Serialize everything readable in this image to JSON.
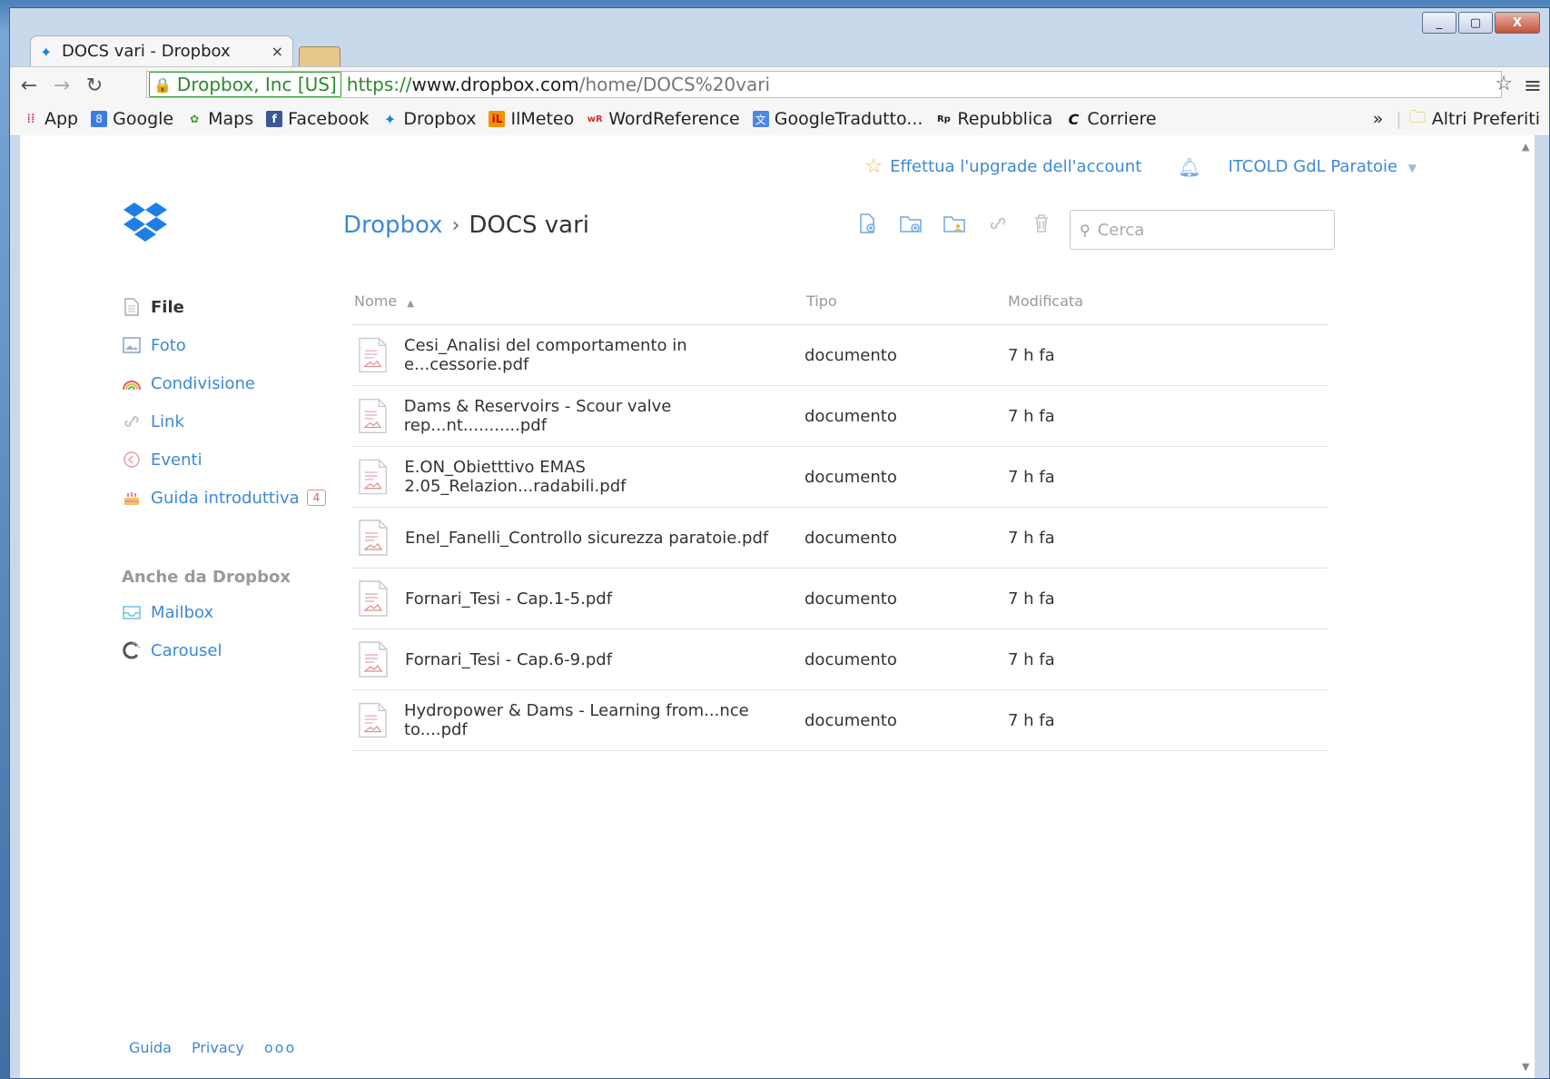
{
  "browser": {
    "tab_title": "DOCS vari - Dropbox",
    "tab_close": "×",
    "ev_label": "Dropbox, Inc [US]",
    "url_scheme": "https://",
    "url_host": "www.dropbox.com",
    "url_path": "/home/DOCS%20vari",
    "bookmarks": [
      {
        "label": "App",
        "icon": "apps-grid-icon"
      },
      {
        "label": "Google",
        "icon": "google-icon"
      },
      {
        "label": "Maps",
        "icon": "maps-icon"
      },
      {
        "label": "Facebook",
        "icon": "facebook-icon"
      },
      {
        "label": "Dropbox",
        "icon": "dropbox-icon"
      },
      {
        "label": "IlMeteo",
        "icon": "ilmeteo-icon"
      },
      {
        "label": "WordReference",
        "icon": "wordreference-icon"
      },
      {
        "label": "GoogleTradutto...",
        "icon": "google-translate-icon"
      },
      {
        "label": "Repubblica",
        "icon": "repubblica-icon"
      },
      {
        "label": "Corriere",
        "icon": "corriere-icon"
      }
    ],
    "overflow": "»",
    "other_bookmarks": "Altri Preferiti"
  },
  "topbar": {
    "upgrade": "Effettua l'upgrade dell'account",
    "account": "ITCOLD GdL Paratoie"
  },
  "breadcrumb": {
    "root": "Dropbox",
    "separator": "›",
    "current": "DOCS vari"
  },
  "search": {
    "placeholder": "Cerca"
  },
  "sidebar": {
    "items": [
      {
        "label": "File",
        "icon": "file-icon"
      },
      {
        "label": "Foto",
        "icon": "photo-icon"
      },
      {
        "label": "Condivisione",
        "icon": "rainbow-share-icon"
      },
      {
        "label": "Link",
        "icon": "link-icon"
      },
      {
        "label": "Eventi",
        "icon": "events-icon"
      },
      {
        "label": "Guida introduttiva",
        "icon": "cake-icon",
        "badge": "4"
      }
    ],
    "section_title": "Anche da Dropbox",
    "extras": [
      {
        "label": "Mailbox",
        "icon": "mailbox-icon"
      },
      {
        "label": "Carousel",
        "icon": "carousel-icon"
      }
    ]
  },
  "table": {
    "headers": {
      "name": "Nome",
      "type": "Tipo",
      "modified": "Modificata"
    },
    "rows": [
      {
        "name": "Cesi_Analisi del comportamento in e...cessorie.pdf",
        "type": "documento",
        "modified": "7 h fa"
      },
      {
        "name": "Dams & Reservoirs - Scour valve rep...nt...........pdf",
        "type": "documento",
        "modified": "7 h fa"
      },
      {
        "name": "E.ON_Obietttivo EMAS 2.05_Relazion...radabili.pdf",
        "type": "documento",
        "modified": "7 h fa"
      },
      {
        "name": "Enel_Fanelli_Controllo sicurezza paratoie.pdf",
        "type": "documento",
        "modified": "7 h fa"
      },
      {
        "name": "Fornari_Tesi - Cap.1-5.pdf",
        "type": "documento",
        "modified": "7 h fa"
      },
      {
        "name": "Fornari_Tesi - Cap.6-9.pdf",
        "type": "documento",
        "modified": "7 h fa"
      },
      {
        "name": "Hydropower & Dams - Learning from...nce to....pdf",
        "type": "documento",
        "modified": "7 h fa"
      }
    ]
  },
  "footer": {
    "help": "Guida",
    "privacy": "Privacy",
    "more": "ooo"
  },
  "colors": {
    "accent": "#3d89d6",
    "dropbox_blue": "#1e7ee6",
    "badge_red": "#e05d5d"
  }
}
